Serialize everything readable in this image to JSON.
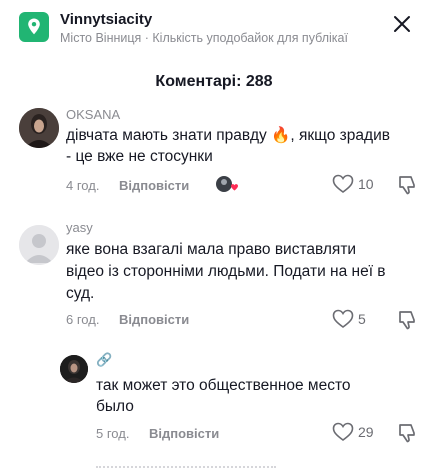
{
  "header": {
    "title": "Vinnytsiacity",
    "subtitle": "Місто Вінниця · Кількість уподобайок для публікаї"
  },
  "comments_title": "Коментарі: 288",
  "comments": [
    {
      "username": "OKSANA",
      "text_line1": "дівчата мають знати правду 🔥, якщо зрадив",
      "text_line2": "- це вже не стосунки",
      "time": "4 год.",
      "reply": "Відповісти",
      "likes": "10"
    },
    {
      "username": "yasy",
      "text_line1": "яке вона взагалі мала право виставляти",
      "text_line2": "відео із сторонніми людьми. Подати на неї в",
      "text_line3": "суд.",
      "time": "6 год.",
      "reply": "Відповісти",
      "likes": "5"
    },
    {
      "username": "🔗",
      "text_line1": "так может это общественное место",
      "text_line2": "было",
      "time": "5 год.",
      "reply": "Відповісти",
      "likes": "29"
    }
  ]
}
